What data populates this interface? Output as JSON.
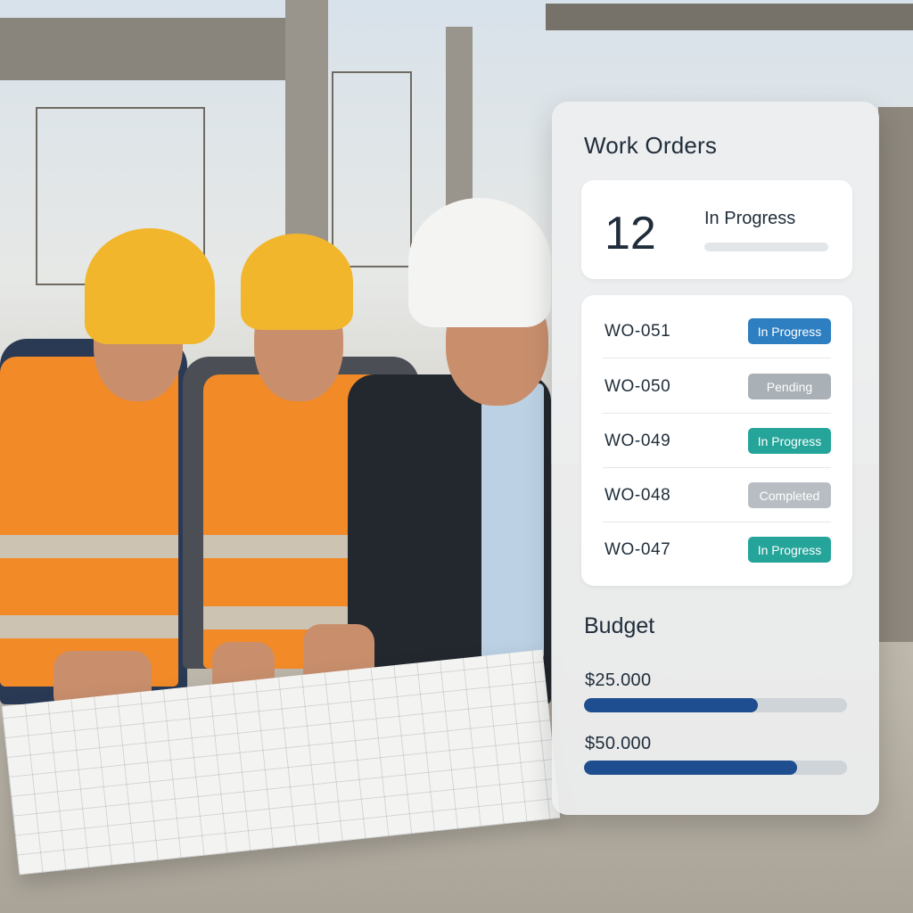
{
  "work_orders": {
    "title": "Work Orders",
    "summary": {
      "count": "12",
      "label": "In Progress"
    },
    "orders": [
      {
        "id": "WO-051",
        "status": "In Progress",
        "color": "#2d7fc1"
      },
      {
        "id": "WO-050",
        "status": "Pending",
        "color": "#a9b0b6"
      },
      {
        "id": "WO-049",
        "status": "In Progress",
        "color": "#25a49a"
      },
      {
        "id": "WO-048",
        "status": "Completed",
        "color": "#b7bdc2"
      },
      {
        "id": "WO-047",
        "status": "In Progress",
        "color": "#25a49a"
      }
    ]
  },
  "budget": {
    "title": "Budget",
    "items": [
      {
        "amount": "$25.000",
        "progress": 0.66
      },
      {
        "amount": "$50.000",
        "progress": 0.81
      }
    ],
    "bar_color": "#1e4e8f"
  }
}
